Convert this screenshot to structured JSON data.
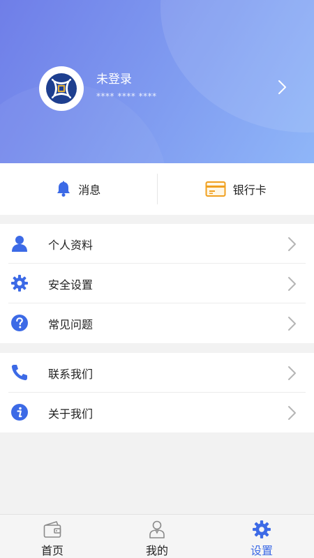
{
  "header": {
    "user_name": "未登录",
    "account_masked": "**** **** ****",
    "colors": {
      "gradient_start": "#6f7ee8",
      "gradient_end": "#8fb6f8"
    }
  },
  "quick_actions": [
    {
      "label": "消息",
      "icon": "bell-icon"
    },
    {
      "label": "银行卡",
      "icon": "bank-card-icon"
    }
  ],
  "menu_group_1": [
    {
      "label": "个人资料",
      "icon": "person-icon"
    },
    {
      "label": "安全设置",
      "icon": "gear-icon"
    },
    {
      "label": "常见问题",
      "icon": "question-icon"
    }
  ],
  "menu_group_2": [
    {
      "label": "联系我们",
      "icon": "phone-icon"
    },
    {
      "label": "关于我们",
      "icon": "info-icon"
    }
  ],
  "tabbar": {
    "tabs": [
      {
        "label": "首页",
        "icon": "wallet-icon",
        "active": false
      },
      {
        "label": "我的",
        "icon": "user-tab-icon",
        "active": false
      },
      {
        "label": "设置",
        "icon": "settings-tab-icon",
        "active": true
      }
    ],
    "active_color": "#3c6ae6"
  },
  "colors": {
    "accent": "#3c6ae6",
    "card_icon": "#f0a020",
    "background": "#f2f2f2"
  }
}
